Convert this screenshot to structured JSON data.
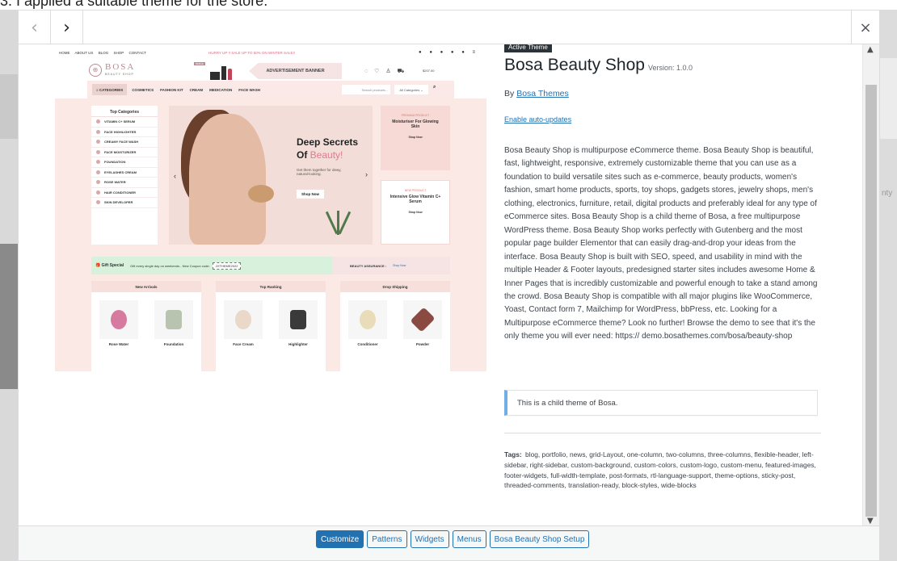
{
  "background_page": {
    "caption": "3. I applied a suitable theme for the store.",
    "right_fragment": "nty"
  },
  "modal": {
    "nav": {
      "prev_icon": "chevron-left-icon",
      "next_icon": "chevron-right-icon",
      "prev_glyph": "‹",
      "next_glyph": "›",
      "close_glyph": "×"
    },
    "footer": {
      "buttons": [
        "Customize",
        "Patterns",
        "Widgets",
        "Menus",
        "Bosa Beauty Shop Setup"
      ]
    }
  },
  "theme_screenshot": {
    "top_links": [
      "HOME",
      "ABOUT US",
      "BLOG",
      "SHOP",
      "CONTACT"
    ],
    "promo_text": "HURRY UP !! SALE UP TO 50% ON WINTER SALE!!",
    "logo_main": "BOSA",
    "logo_sub": "BEAUTY SHOP",
    "ad_tag": "BEBAE",
    "ad_banner": "ADVERTISEMENT BANNER",
    "cart_amount": "$207.00",
    "menu": {
      "categories": "CATEGORIES",
      "items": [
        "COSMETICS",
        "FASHION KIT",
        "CREAM",
        "MEDICATION",
        "FACE WASH"
      ],
      "search_placeholder": "Search products...",
      "all_categories": "All Categories"
    },
    "top_categories_title": "Top Categories",
    "top_categories": [
      "VITAMIN C+ SERUM",
      "FACE HIGHLIGHTER",
      "CREAMY FACE WASH",
      "FACE MOISTURIZER",
      "FOUNDATION",
      "EYELASHES CREAM",
      "ROSE WATER",
      "HAIR CONDITIONER",
      "SKIN DEVELOPER"
    ],
    "hero": {
      "line1": "Deep Secrets",
      "line2_a": "Of ",
      "line2_b": "Beauty!",
      "sub": "Get them together for dewy, natural-looking.",
      "button": "Shop Now"
    },
    "promo1": {
      "label": "PREMIUM PRODUCT",
      "title": "Moisturiser For Glowing Skin",
      "button": "Shop Now"
    },
    "promo2": {
      "label": "NEW PRODUCT",
      "title": "Intensive Glow Vitamin C+ Serum",
      "button": "Shop Now"
    },
    "gift": {
      "title": "Gift Special",
      "text": "Gift every single day on weekends - New Coupon code:",
      "code": "2XTHEME2022",
      "assurance": "BEAUTY ASSURANCE :",
      "assurance_link": "Shop Now"
    },
    "columns": [
      {
        "title": "New Arrivals",
        "products": [
          "Rose Water",
          "Foundation"
        ]
      },
      {
        "title": "Top Ranking",
        "products": [
          "Face Cream",
          "Highlighter"
        ]
      },
      {
        "title": "Drop Shipping",
        "products": [
          "Conditioner",
          "Powder"
        ]
      }
    ]
  },
  "theme_info": {
    "badge": "Active Theme",
    "name": "Bosa Beauty Shop",
    "version": "Version: 1.0.0",
    "by": "By",
    "author": "Bosa Themes",
    "auto_updates": "Enable auto-updates",
    "description": "Bosa Beauty Shop is multipurpose eCommerce theme. Bosa Beauty Shop is beautiful, fast, lightweight, responsive, extremely customizable theme that you can use as a foundation to build versatile sites such as e-commerce, beauty products, women's fashion, smart home products, sports, toy shops, gadgets stores, jewelry shops, men's clothing, electronics, furniture, retail, digital products and preferably ideal for any type of eCommerce sites. Bosa Beauty Shop is a child theme of Bosa, a free multipurpose WordPress theme. Bosa Beauty Shop works perfectly with Gutenberg and the most popular page builder Elementor that can easily drag-and-drop your ideas from the interface. Bosa Beauty Shop is built with SEO, speed, and usability in mind with the multiple Header & Footer layouts, predesigned starter sites includes awesome Home & Inner Pages that is incredibly customizable and powerful enough to take a stand among the crowd. Bosa Beauty Shop is compatible with all major plugins like WooCommerce, Yoast, Contact form 7, Mailchimp for WordPress, bbPress, etc. Looking for a Multipurpose eCommerce theme? Look no further! Browse the demo to see that it's the only theme you will ever need: https:// demo.bosathemes.com/bosa/beauty-shop",
    "parent_text": "This is a child theme of",
    "parent_name": "Bosa.",
    "tags_label": "Tags:",
    "tags": "blog, portfolio, news, grid-Layout, one-column, two-columns, three-columns, flexible-header, left-sidebar, right-sidebar, custom-background, custom-colors, custom-logo, custom-menu, featured-images, footer-widgets, full-width-template, post-formats, rtl-language-support, theme-options, sticky-post, threaded-comments, translation-ready, block-styles, wide-blocks"
  },
  "colors": {
    "wp_blue": "#2271b1",
    "accent_pink": "#e07a8c",
    "border": "#dcdcde"
  }
}
